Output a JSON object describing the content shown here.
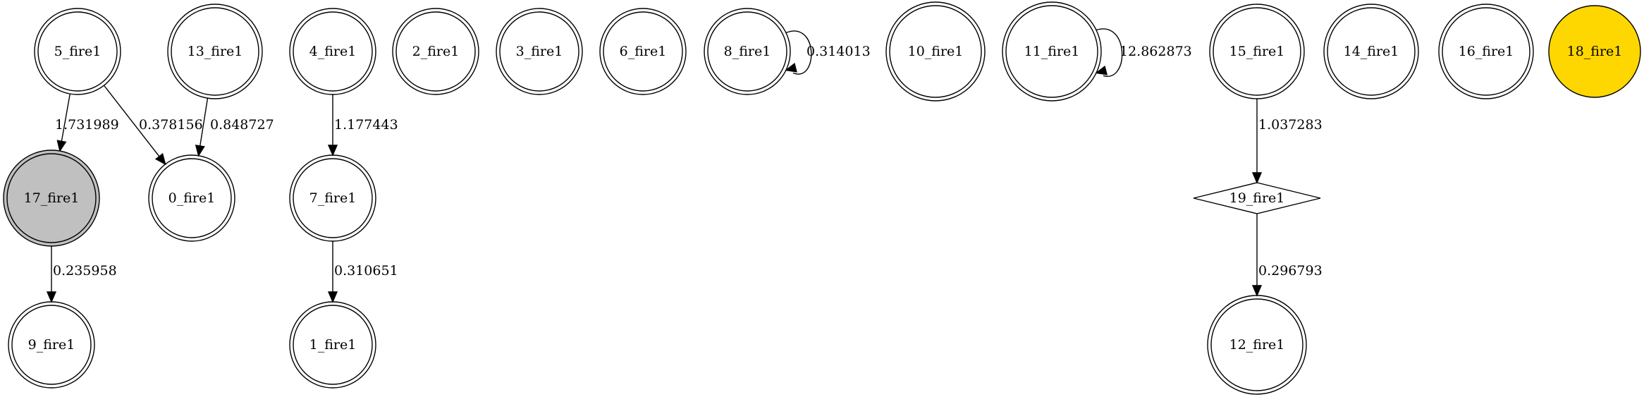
{
  "colors": {
    "gray_fill": "#c0c0c0",
    "gold_fill": "#ffd700",
    "stroke": "#000000",
    "background": "#ffffff"
  },
  "nodes": [
    {
      "id": "5_fire1",
      "label": "5_fire1",
      "shape": "doublecircle"
    },
    {
      "id": "13_fire1",
      "label": "13_fire1",
      "shape": "doublecircle"
    },
    {
      "id": "4_fire1",
      "label": "4_fire1",
      "shape": "doublecircle"
    },
    {
      "id": "2_fire1",
      "label": "2_fire1",
      "shape": "doublecircle"
    },
    {
      "id": "3_fire1",
      "label": "3_fire1",
      "shape": "doublecircle"
    },
    {
      "id": "6_fire1",
      "label": "6_fire1",
      "shape": "doublecircle"
    },
    {
      "id": "8_fire1",
      "label": "8_fire1",
      "shape": "doublecircle"
    },
    {
      "id": "10_fire1",
      "label": "10_fire1",
      "shape": "doublecircle"
    },
    {
      "id": "11_fire1",
      "label": "11_fire1",
      "shape": "doublecircle"
    },
    {
      "id": "15_fire1",
      "label": "15_fire1",
      "shape": "doublecircle"
    },
    {
      "id": "14_fire1",
      "label": "14_fire1",
      "shape": "doublecircle"
    },
    {
      "id": "16_fire1",
      "label": "16_fire1",
      "shape": "doublecircle"
    },
    {
      "id": "18_fire1",
      "label": "18_fire1",
      "shape": "circle",
      "fill": "gold"
    },
    {
      "id": "17_fire1",
      "label": "17_fire1",
      "shape": "doublecircle",
      "fill": "gray"
    },
    {
      "id": "0_fire1",
      "label": "0_fire1",
      "shape": "doublecircle"
    },
    {
      "id": "7_fire1",
      "label": "7_fire1",
      "shape": "doublecircle"
    },
    {
      "id": "19_fire1",
      "label": "19_fire1",
      "shape": "diamond"
    },
    {
      "id": "9_fire1",
      "label": "9_fire1",
      "shape": "doublecircle"
    },
    {
      "id": "1_fire1",
      "label": "1_fire1",
      "shape": "doublecircle"
    },
    {
      "id": "12_fire1",
      "label": "12_fire1",
      "shape": "doublecircle"
    }
  ],
  "edges": [
    {
      "from": "5_fire1",
      "to": "17_fire1",
      "label": "1.731989"
    },
    {
      "from": "5_fire1",
      "to": "0_fire1",
      "label": "0.378156"
    },
    {
      "from": "13_fire1",
      "to": "0_fire1",
      "label": "0.848727"
    },
    {
      "from": "4_fire1",
      "to": "7_fire1",
      "label": "1.177443"
    },
    {
      "from": "8_fire1",
      "to": "8_fire1",
      "label": "0.314013"
    },
    {
      "from": "11_fire1",
      "to": "11_fire1",
      "label": "12.862873"
    },
    {
      "from": "15_fire1",
      "to": "19_fire1",
      "label": "1.037283"
    },
    {
      "from": "17_fire1",
      "to": "9_fire1",
      "label": "0.235958"
    },
    {
      "from": "7_fire1",
      "to": "1_fire1",
      "label": "0.310651"
    },
    {
      "from": "19_fire1",
      "to": "12_fire1",
      "label": "0.296793"
    }
  ]
}
